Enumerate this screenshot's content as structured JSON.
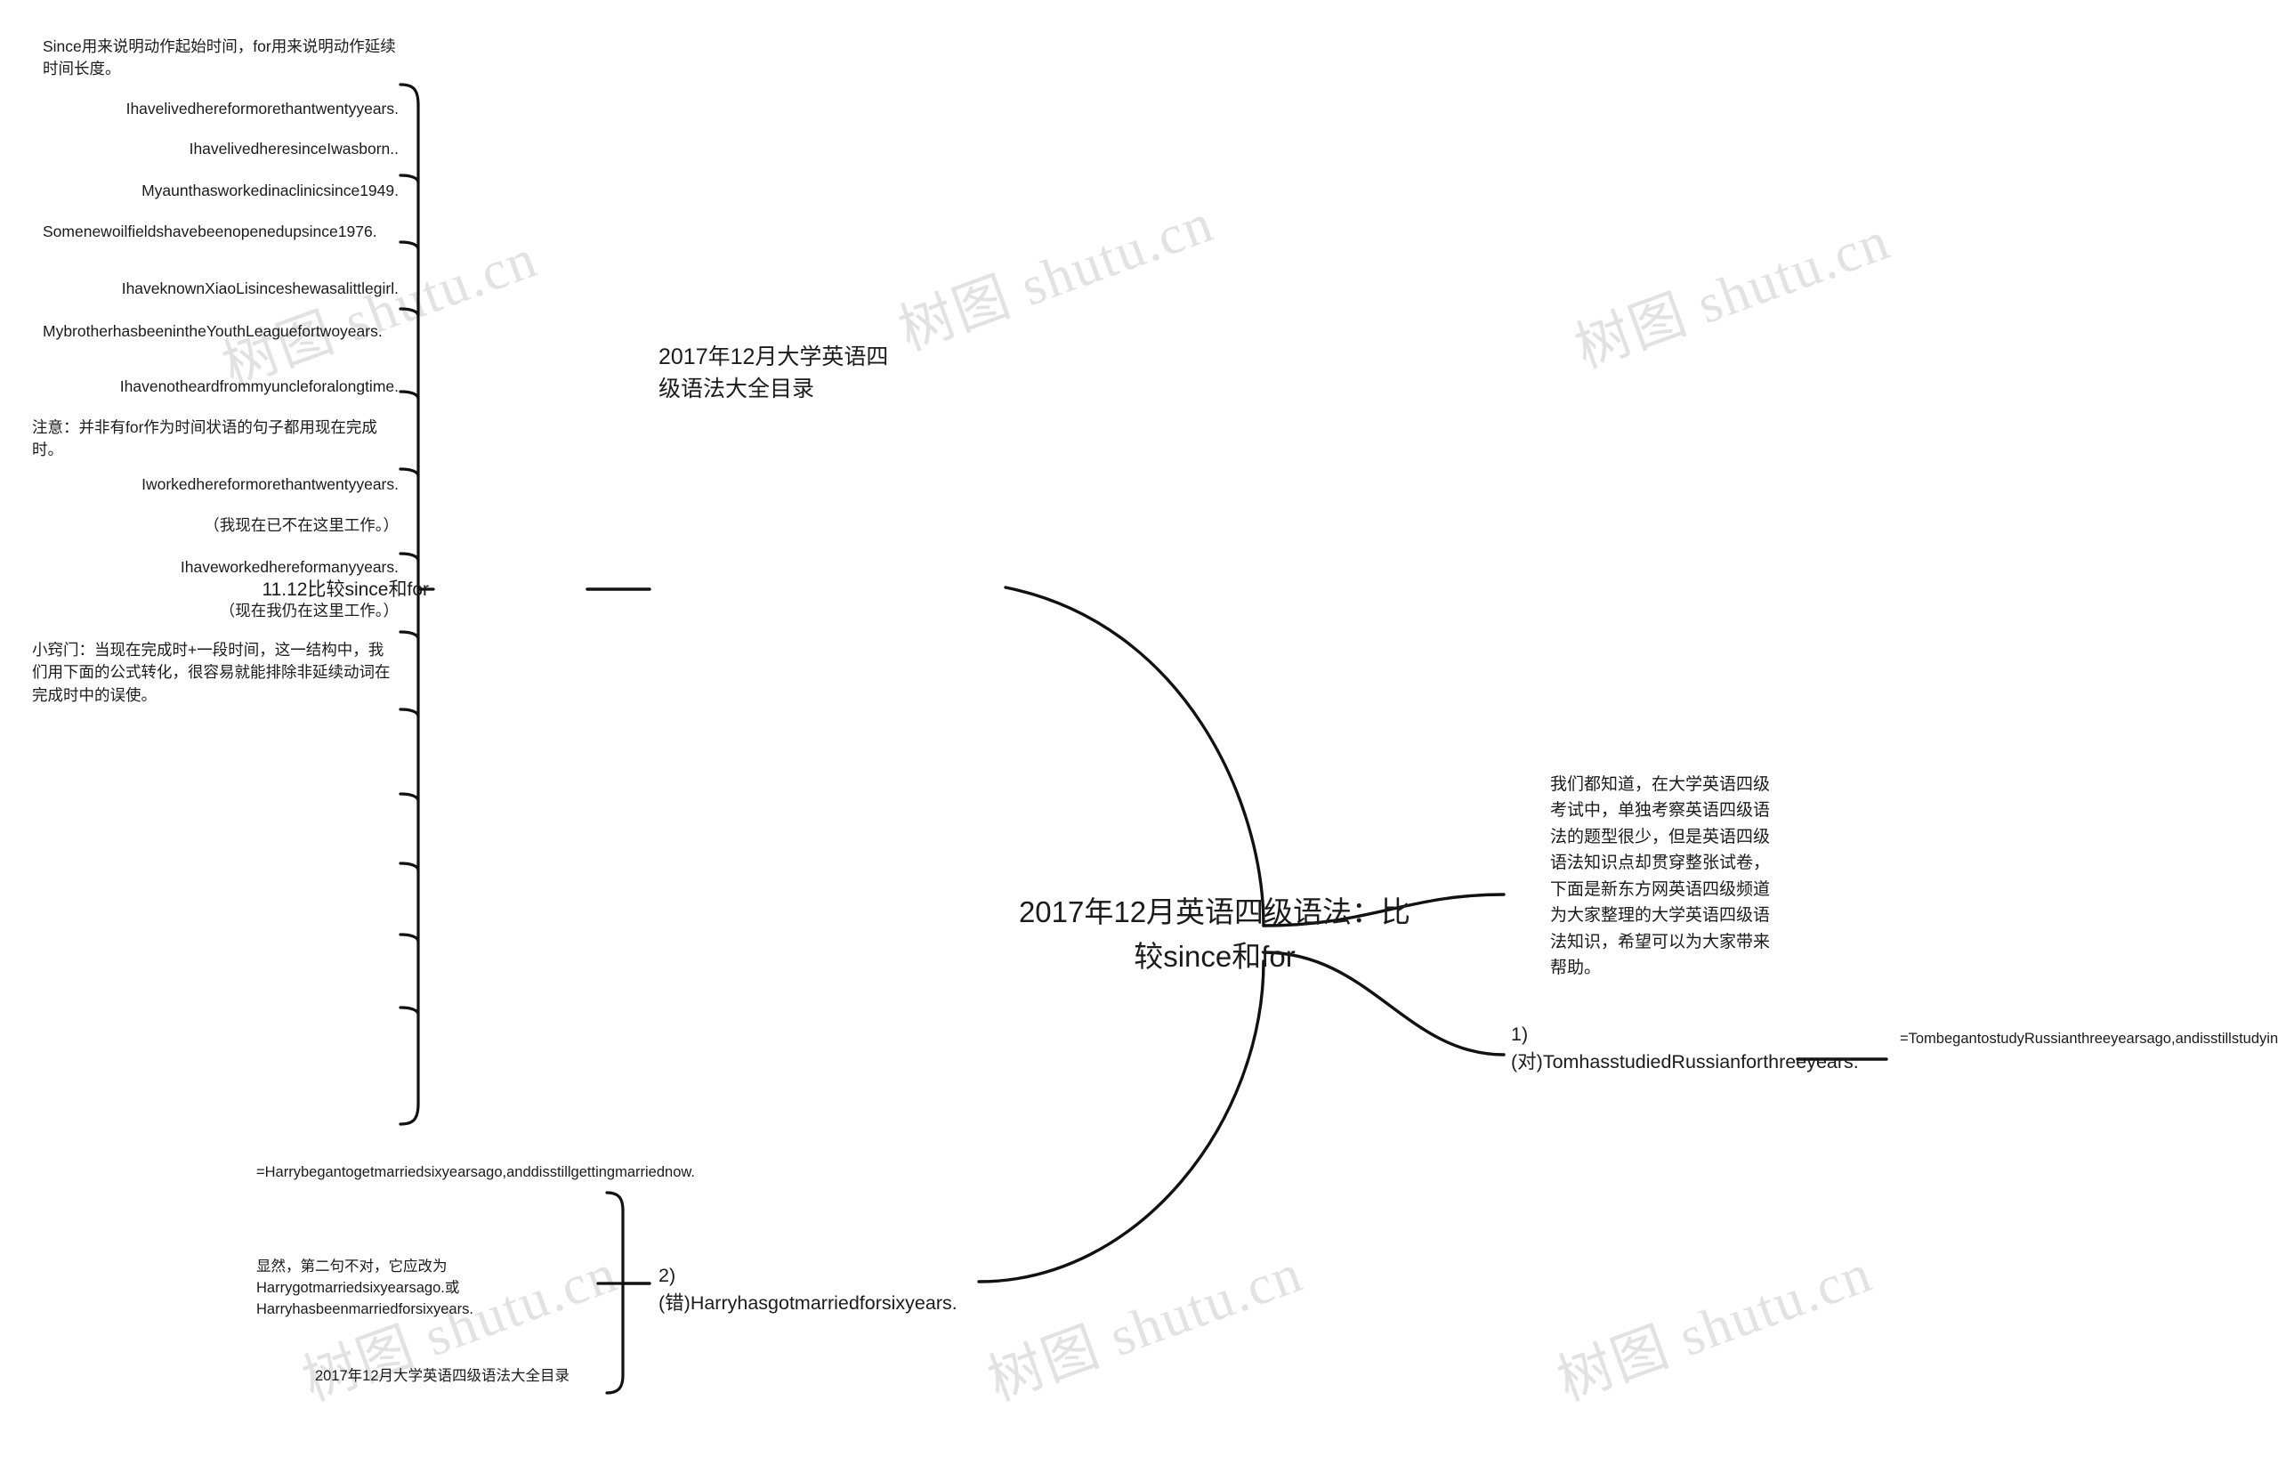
{
  "document": {
    "title": "2017年12月英语四级语法：比较since和for",
    "type": "mindmap",
    "background_color": "#ffffff",
    "line_color": "#111111",
    "text_color": "#1b1b1b"
  },
  "watermarks": [
    {
      "text": "树图 shutu.cn"
    },
    {
      "text": "树图 shutu.cn"
    },
    {
      "text": "树图 shutu.cn"
    },
    {
      "text": "树图 shutu.cn"
    },
    {
      "text": "树图 shutu.cn"
    },
    {
      "text": "树图 shutu.cn"
    }
  ],
  "root": {
    "label": "2017年12月英语四级语法：比较since和for"
  },
  "branches": {
    "catalog_top": {
      "label": "2017年12月大学英语四级语法大全目录"
    },
    "intro": {
      "label": "我们都知道，在大学英语四级考试中，单独考察英语四级语法的题型很少，但是英语四级语法知识点却贯穿整张试卷，下面是新东方网英语四级频道为大家整理的大学英语四级语法知识，希望可以为大家带来帮助。"
    },
    "topic_since_for": {
      "label": "11.12比较since和for"
    },
    "example1": {
      "label": "1)(对)TomhasstudiedRussianforthreeyears.",
      "note": "=TombegantostudyRussianthreeyearsago,andisstillstudyingitnow."
    },
    "example2": {
      "label": "2)(错)Harryhasgotmarriedforsixyears.",
      "notes": [
        "=Harrybegantogetmarriedsixyearsago,anddisstillgettingmarriednow.",
        "显然，第二句不对，它应改为Harrygotmarriedsixyearsago.或Harryhasbeenmarriedforsixyears.",
        "2017年12月大学英语四级语法大全目录"
      ]
    }
  },
  "since_for_children": [
    {
      "id": "rule",
      "label": "Since用来说明动作起始时间，for用来说明动作延续时间长度。"
    },
    {
      "id": "ex-a",
      "label": "Ihavelivedhereformorethantwentyyears."
    },
    {
      "id": "ex-b",
      "label": "IhavelivedheresinceIwasborn.."
    },
    {
      "id": "ex-c",
      "label": "Myaunthasworkedinaclinicsince1949."
    },
    {
      "id": "ex-d",
      "label": "Somenewoilfieldshavebeenopenedupsince1976."
    },
    {
      "id": "ex-e",
      "label": "IhaveknownXiaoLisinceshewasalittlegirl."
    },
    {
      "id": "ex-f",
      "label": "MybrotherhasbeenintheYouthLeaguefortwoyears."
    },
    {
      "id": "ex-g",
      "label": "Ihavenotheardfrommyuncleforalongtime."
    },
    {
      "id": "note-1",
      "label": "注意：并非有for作为时间状语的句子都用现在完成时。"
    },
    {
      "id": "ex-h",
      "label": "Iworkedhereformorethantwentyyears."
    },
    {
      "id": "ex-h2",
      "label": "（我现在已不在这里工作。）"
    },
    {
      "id": "ex-i",
      "label": "Ihaveworkedhereformanyyears."
    },
    {
      "id": "ex-i2",
      "label": "（现在我仍在这里工作。）"
    },
    {
      "id": "tip",
      "label": "小窍门：当现在完成时+一段时间，这一结构中，我们用下面的公式转化，很容易就能排除非延续动词在完成时中的误使。"
    }
  ]
}
